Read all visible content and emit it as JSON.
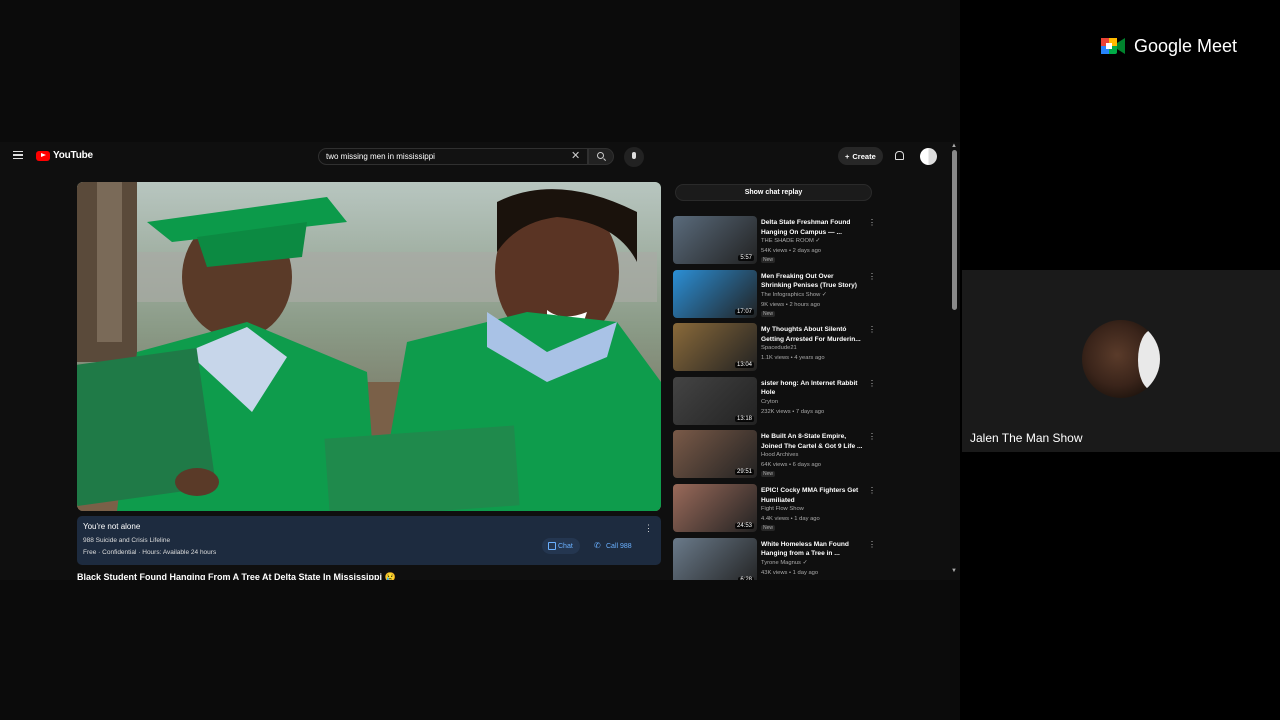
{
  "meet": {
    "brand": "Google Meet",
    "participant_name": "Jalen The Man Show"
  },
  "youtube": {
    "logo": "YouTube",
    "search_query": "two missing men in mississippi",
    "create_label": "Create",
    "chat_replay_label": "Show chat replay",
    "video_title": "Black Student Found Hanging From A Tree At Delta State In Mississippi 😢",
    "crisis": {
      "heading": "You're not alone",
      "line": "988 Suicide and Crisis Lifeline",
      "details": "Free · Confidential · Hours: Available 24 hours",
      "chat_label": "Chat",
      "call_label": "Call 988"
    },
    "recommendations": [
      {
        "title": "Delta State Freshman Found Hanging On Campus — ...",
        "channel": "THE SHADE ROOM ✓",
        "stats": "54K views • 2 days ago",
        "badge": "New",
        "duration": "5:57",
        "thumb_color": "#5a6b7c"
      },
      {
        "title": "Men Freaking Out Over Shrinking Penises (True Story)",
        "channel": "The Infographics Show ✓",
        "stats": "9K views • 2 hours ago",
        "badge": "New",
        "duration": "17:07",
        "thumb_color": "#2b8fd6"
      },
      {
        "title": "My Thoughts About Silentó Getting Arrested For Murderin...",
        "channel": "Spacedude21",
        "stats": "1.1K views • 4 years ago",
        "badge": "",
        "duration": "13:04",
        "thumb_color": "#8a6a3a"
      },
      {
        "title": "sister hong: An Internet Rabbit Hole",
        "channel": "Cryton",
        "stats": "232K views • 7 days ago",
        "badge": "",
        "duration": "13:18",
        "thumb_color": "#444444"
      },
      {
        "title": "He Built An 8-State Empire, Joined The Cartel & Got 9 Life ...",
        "channel": "Hood Archives",
        "stats": "64K views • 6 days ago",
        "badge": "New",
        "duration": "29:51",
        "thumb_color": "#7a5a48"
      },
      {
        "title": "EPIC! Cocky MMA Fighters Get Humiliated",
        "channel": "Fight Flow Show",
        "stats": "4.4K views • 1 day ago",
        "badge": "New",
        "duration": "24:53",
        "thumb_color": "#9a6a5a"
      },
      {
        "title": "White Homeless Man Found Hanging from a Tree in ...",
        "channel": "Tyrone Magnus ✓",
        "stats": "43K views • 1 day ago",
        "badge": "",
        "duration": "6:28",
        "thumb_color": "#6a7a8a"
      }
    ]
  }
}
